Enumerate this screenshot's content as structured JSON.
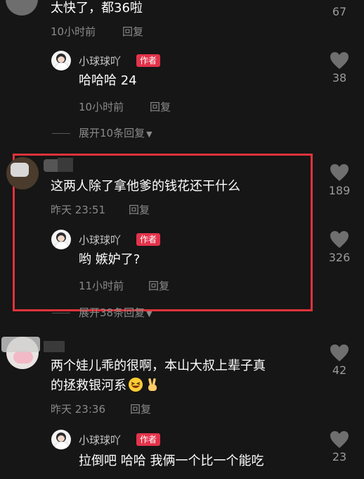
{
  "comments": [
    {
      "text": "太快了，都36啦",
      "time": "10小时前",
      "reply_label": "回复",
      "likes": "67",
      "reply": {
        "author": "小球球吖",
        "badge": "作者",
        "text": "哈哈哈 24",
        "time": "10小时前",
        "reply_label": "回复",
        "likes": "38"
      },
      "expand_label": "展开10条回复"
    },
    {
      "text": "这两人除了拿他爹的钱花还干什么",
      "time": "昨天 23:51",
      "reply_label": "回复",
      "likes": "189",
      "reply": {
        "author": "小球球吖",
        "badge": "作者",
        "text": "哟 嫉妒了?",
        "time": "11小时前",
        "reply_label": "回复",
        "likes": "326"
      },
      "expand_label": "展开38条回复"
    },
    {
      "text_line1": "两个娃儿乖的很啊，本山大叔上辈子真",
      "text_line2": "的拯救银河系",
      "time": "昨天 23:36",
      "reply_label": "回复",
      "likes": "42",
      "reply": {
        "author": "小球球吖",
        "badge": "作者",
        "text": "拉倒吧 哈哈 我俩一个比一个能吃",
        "likes": "23"
      }
    }
  ],
  "icons": {
    "like": "heart-icon",
    "expand": "chevron-down-icon",
    "emoji1": "grinning-squint-emoji-icon",
    "emoji2": "victory-hand-emoji-icon"
  },
  "colors": {
    "background": "#161616",
    "badge": "#e3334b",
    "highlight_box": "#e0323a",
    "muted_text": "#8a8a8a"
  }
}
